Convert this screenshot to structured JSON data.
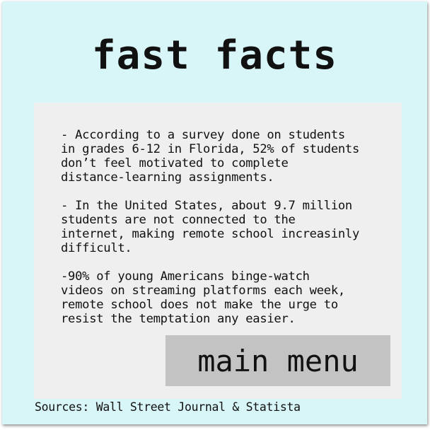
{
  "title": "fast facts",
  "facts": [
    "- According to a survey done on students\nin grades 6-12 in Florida, 52% of students\ndon’t feel motivated to complete\ndistance-learning assignments.",
    "- In the United States, about 9.7 million\nstudents are not connected to the\ninternet, making remote school increasinly\ndifficult.",
    "-90% of young Americans binge-watch\nvideos on streaming platforms each week,\nremote school does not make the urge to\nresist the temptation any easier."
  ],
  "main_menu_button": {
    "label": "main menu"
  },
  "sources": "Sources: Wall Street Journal & Statista",
  "colors": {
    "background": "#d8f5f8",
    "panel": "#efefef",
    "button": "#c3c3c3",
    "text": "#111111"
  }
}
